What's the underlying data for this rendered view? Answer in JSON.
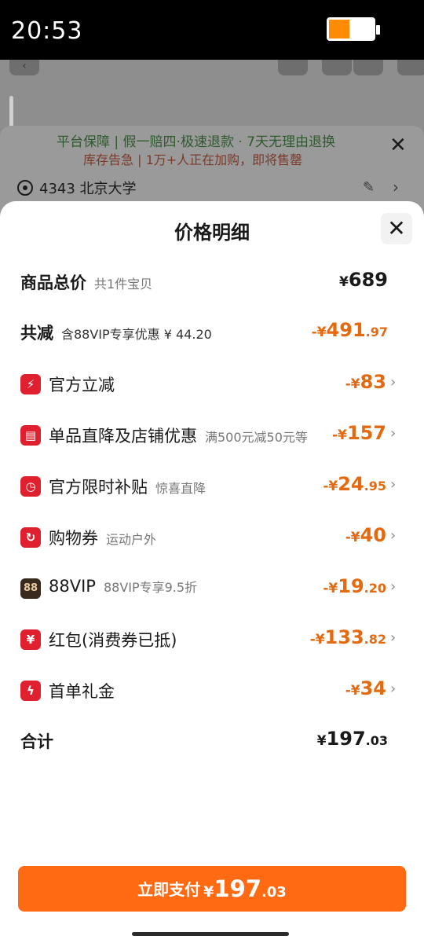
{
  "status_bar": {
    "time": "20:53"
  },
  "background": {
    "guarantee_text": "平台保障 | 假一赔四·极速退款 · 7天无理由退换",
    "stock_text": "库存告急 | 1万+人正在加购，即将售罄",
    "address": "4343 北京大学"
  },
  "sheet": {
    "title": "价格明细",
    "total_label": "商品总价",
    "total_sub": "共1件宝贝",
    "total_yen": "¥",
    "total_int": "689",
    "reduce_label": "共减",
    "reduce_sub": "含88VIP专享优惠 ¥ 44.20",
    "reduce_prefix": "-¥",
    "reduce_int": "491",
    "reduce_dec": ".97",
    "items": [
      {
        "label": "官方立减",
        "sub": "",
        "icon": "lightning-icon",
        "prefix": "-¥",
        "int": "83",
        "dec": ""
      },
      {
        "label": "单品直降及店铺优惠",
        "sub": "满500元减50元等",
        "icon": "shop-icon",
        "prefix": "-¥",
        "int": "157",
        "dec": ""
      },
      {
        "label": "官方限时补贴",
        "sub": "惊喜直降",
        "icon": "clock-icon",
        "prefix": "-¥",
        "int": "24",
        "dec": ".95"
      },
      {
        "label": "购物券",
        "sub": "运动户外",
        "icon": "coupon-icon",
        "prefix": "-¥",
        "int": "40",
        "dec": ""
      },
      {
        "label": "88VIP",
        "sub": "88VIP专享9.5折",
        "icon": "vip-88-icon",
        "icon_text": "88",
        "prefix": "-¥",
        "int": "19",
        "dec": ".20"
      },
      {
        "label": "红包(消费券已抵)",
        "sub": "",
        "icon": "red-packet-icon",
        "prefix": "-¥",
        "int": "133",
        "dec": ".82"
      },
      {
        "label": "首单礼金",
        "sub": "",
        "icon": "gift-cash-icon",
        "prefix": "-¥",
        "int": "34",
        "dec": ""
      }
    ],
    "sum_label": "合计",
    "sum_yen": "¥",
    "sum_int": "197",
    "sum_dec": ".03"
  },
  "pay_button": {
    "label": "立即支付",
    "yen": "¥",
    "int": "197",
    "dec": ".03"
  },
  "colors": {
    "accent": "#ff6a12",
    "discount": "#e36a10",
    "icon_red": "#e0202f"
  }
}
